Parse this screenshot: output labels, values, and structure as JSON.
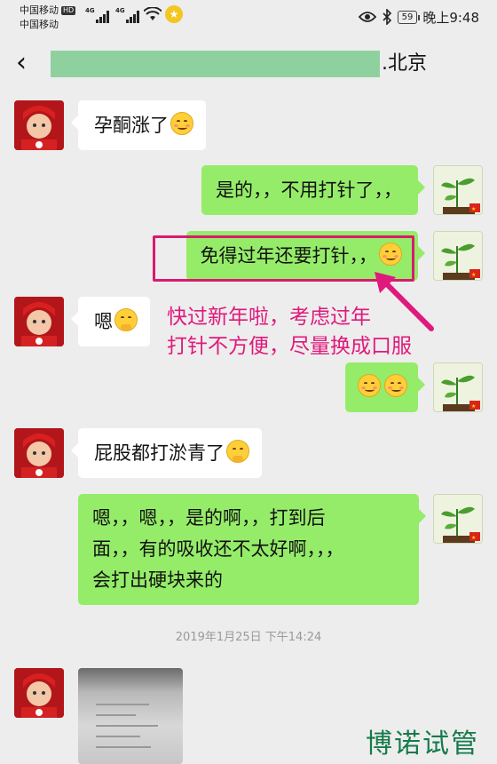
{
  "status_bar": {
    "carrier_1": "中国移动",
    "carrier_1_badge": "HD",
    "carrier_2": "中国移动",
    "net_1": "4G",
    "net_2": "4G",
    "battery": "59",
    "time": "晚上9:48"
  },
  "header": {
    "title_suffix": ".北京"
  },
  "messages": [
    {
      "side": "in",
      "text": "孕酮涨了",
      "emoji": "smile"
    },
    {
      "side": "out",
      "text": "是的，，不用打针了，，"
    },
    {
      "side": "out",
      "text": "免得过年还要打针，，",
      "emoji": "smile"
    },
    {
      "side": "in",
      "text": "嗯",
      "emoji": "thinking"
    },
    {
      "side": "out",
      "text": "",
      "emoji": "smile-smile"
    },
    {
      "side": "in",
      "text": "屁股都打淤青了",
      "emoji": "thinking"
    },
    {
      "side": "out",
      "lines": [
        "嗯，，嗯，，是的啊，，打到后",
        "面，，有的吸收还不太好啊，，，",
        "会打出硬块来的"
      ]
    }
  ],
  "annotation": {
    "line_1": "快过新年啦，考虑过年",
    "line_2": "打针不方便，尽量换成口服"
  },
  "timestamp": "2019年1月25日 下午14:24",
  "watermark": "博诺试管",
  "colors": {
    "background": "#ededed",
    "bubble_out": "#95ec69",
    "bubble_in": "#ffffff",
    "annotation": "#e0197c",
    "redaction": "#8fd19e"
  }
}
